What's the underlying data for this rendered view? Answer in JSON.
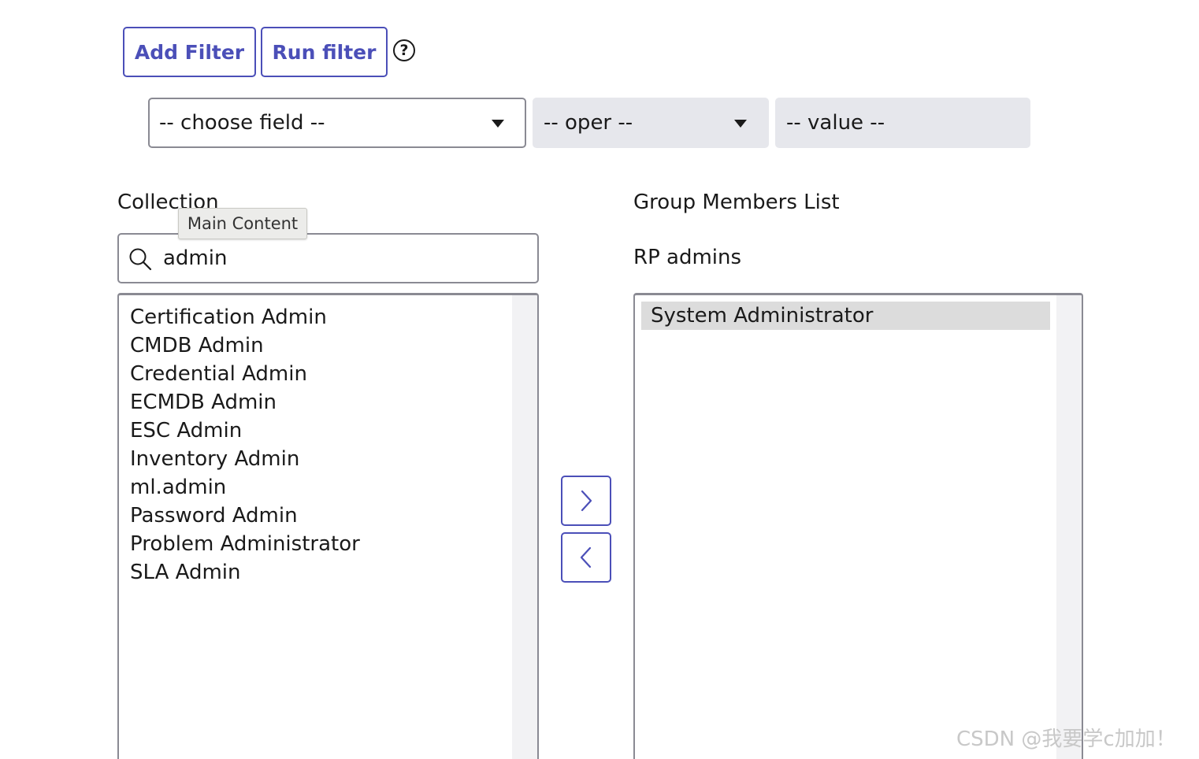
{
  "toolbar": {
    "add_filter_label": "Add Filter",
    "run_filter_label": "Run filter",
    "help_glyph": "?"
  },
  "filter": {
    "field_value": "-- choose field --",
    "oper_value": "-- oper --",
    "value_placeholder": "-- value --"
  },
  "collection": {
    "heading": "Collection",
    "search_value": "admin",
    "tooltip": "Main Content",
    "items": [
      "Certification Admin",
      "CMDB Admin",
      "Credential Admin",
      "ECMDB Admin",
      "ESC Admin",
      "Inventory Admin",
      "ml.admin",
      "Password Admin",
      "Problem Administrator",
      "SLA Admin"
    ]
  },
  "members": {
    "heading": "Group Members List",
    "group_name": "RP admins",
    "items": [
      "System Administrator"
    ],
    "selected_item": "System Administrator"
  },
  "transfer": {
    "add_icon": "chevron-right-icon",
    "remove_icon": "chevron-left-icon"
  },
  "watermark": "CSDN @我要学c加加！",
  "colors": {
    "accent": "#4b4fb8",
    "disabled_bg": "#e6e7ec",
    "selected_bg": "#dcdcdc"
  }
}
